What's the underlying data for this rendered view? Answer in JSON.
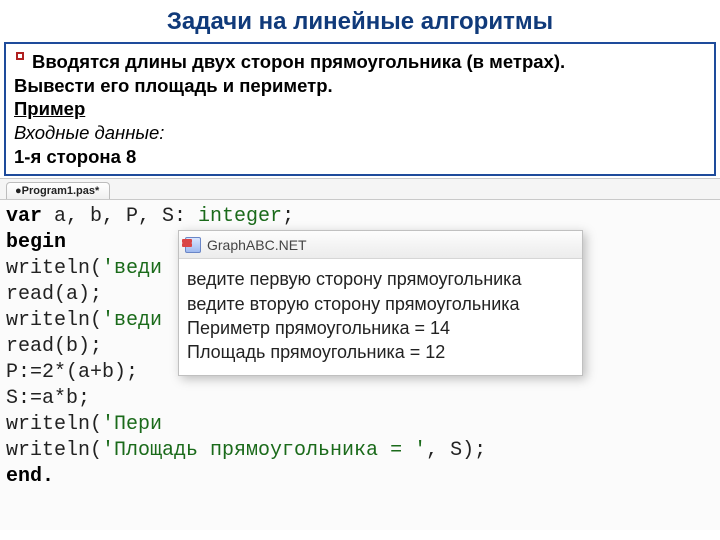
{
  "title": "Задачи на линейные алгоритмы",
  "task": {
    "line1": "Вводятся длины двух сторон прямоугольника (в метрах).",
    "line2": "Вывести его площадь и периметр.",
    "example_label": "Пример",
    "input_label": "Входные данные:",
    "input_row": "1-я сторона 8"
  },
  "tab": "●Program1.pas*",
  "code": {
    "l1_var": "var",
    "l1_decl": " a, b, P, S: ",
    "l1_type": "integer",
    "l1_end": ";",
    "l2": "begin",
    "l3a": "writeln(",
    "l3s": "'веди",
    "l4": "read(a);",
    "l5a": "writeln(",
    "l5s": "'веди",
    "l6": "read(b);",
    "l7": "P:=2*(a+b);",
    "l8": "S:=a*b;",
    "l9a": "writeln(",
    "l9s": "'Пери",
    "l10a": "writeln(",
    "l10s": "'Площадь прямоугольника = '",
    "l10b": ", S);",
    "l11": "end."
  },
  "popup": {
    "title": "GraphABC.NET",
    "line1": "ведите первую сторону прямоугольника",
    "line2": "ведите вторую сторону прямоугольника",
    "line3": "Периметр прямоугольника = 14",
    "line4": "Площадь прямоугольника = 12"
  }
}
